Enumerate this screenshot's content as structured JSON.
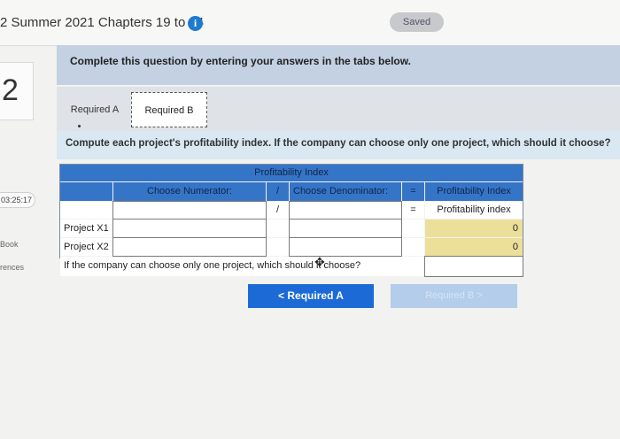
{
  "header": {
    "title": "2 Summer 2021 Chapters 19 to 24",
    "info_glyph": "i",
    "saved": "Saved"
  },
  "left_panel": {
    "question_number": "2",
    "timer": "03:25:17",
    "label_book": "Book",
    "label_references": "rences"
  },
  "instructions": "Complete this question by entering your answers in the tabs below.",
  "tabs": [
    {
      "label": "Required A",
      "active": false
    },
    {
      "label": "Required B",
      "active": true
    }
  ],
  "question_text": "Compute each project's profitability index. If the company can choose only one project, which should it choose?",
  "table": {
    "title": "Profitability Index",
    "col_numerator": "Choose Numerator:",
    "divide": "/",
    "col_denominator": "Choose Denominator:",
    "equals": "=",
    "col_result": "Profitability Index",
    "formula_result": "Profitability index",
    "rows": [
      {
        "label": "Project X1",
        "result": "0"
      },
      {
        "label": "Project X2",
        "result": "0"
      }
    ],
    "choose_label": "If the company can choose only one project, which should it choose?"
  },
  "nav": {
    "prev_label": "<  Required A",
    "next_label": "Required B  >"
  },
  "colors": {
    "header_blue": "#3575c7",
    "button_blue": "#1c6ad6",
    "result_yellow": "#ecdf9a"
  }
}
